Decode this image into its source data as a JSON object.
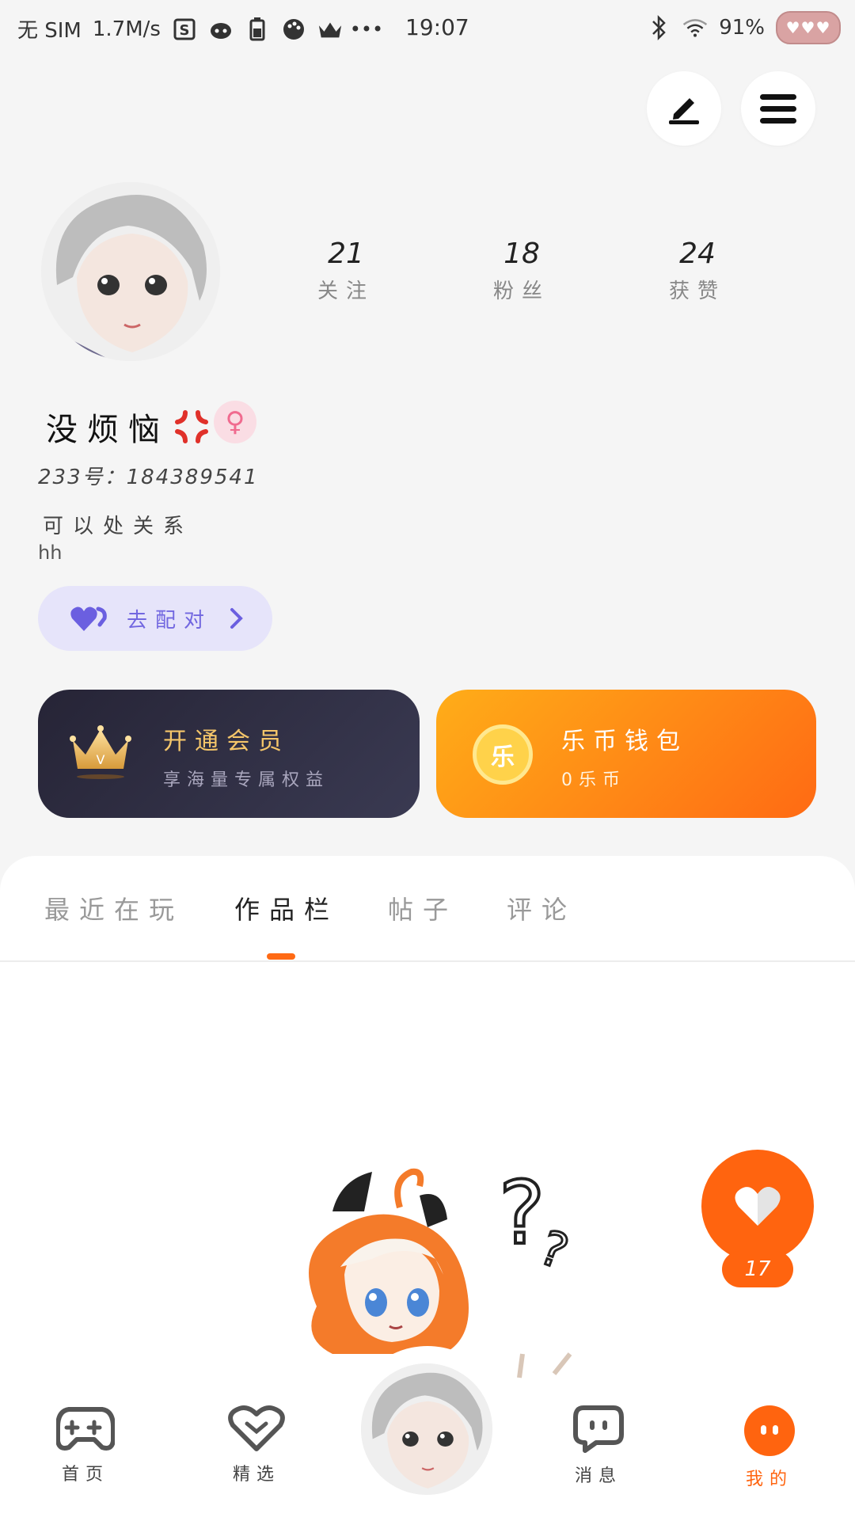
{
  "status_bar": {
    "carrier": "无 SIM",
    "speed": "1.7M/s",
    "time": "19:07",
    "battery_percent": "91%",
    "icons": [
      "s-icon",
      "cat-icon",
      "battery-saver-icon",
      "palette-icon",
      "crown-icon",
      "more-dots-icon",
      "bluetooth-icon",
      "wifi-icon"
    ]
  },
  "header": {
    "edit_icon": "pen-icon",
    "menu_icon": "menu-icon"
  },
  "profile": {
    "stats": [
      {
        "value": "21",
        "label": "关注"
      },
      {
        "value": "18",
        "label": "粉丝"
      },
      {
        "value": "24",
        "label": "获赞"
      }
    ],
    "username": "没烦恼",
    "gender_symbol": "♀",
    "id_line": "233号：184389541",
    "signature": "可以处关系",
    "bio": "hh"
  },
  "pair_button": {
    "label": "去配对"
  },
  "vip_card": {
    "title": "开通会员",
    "subtitle": "享海量专属权益"
  },
  "wallet_card": {
    "title": "乐币钱包",
    "subtitle": "0乐币",
    "coin_char": "乐"
  },
  "tabs": [
    {
      "label": "最近在玩",
      "active": false
    },
    {
      "label": "作品栏",
      "active": true
    },
    {
      "label": "帖子",
      "active": false
    },
    {
      "label": "评论",
      "active": false
    }
  ],
  "like_fab": {
    "count": "17"
  },
  "bottom_nav": [
    {
      "label": "首页",
      "icon": "gamepad-icon",
      "active": false
    },
    {
      "label": "精选",
      "icon": "heart-gem-icon",
      "active": false
    },
    {
      "label": "",
      "icon": "avatar",
      "active": false
    },
    {
      "label": "消息",
      "icon": "chat-bubble-icon",
      "active": false
    },
    {
      "label": "我的",
      "icon": "profile-face-icon",
      "active": true
    }
  ],
  "colors": {
    "accent": "#ff640f",
    "purple": "#7267e0",
    "vip_gold": "#f5c66a",
    "pink": "#f06b8f"
  }
}
